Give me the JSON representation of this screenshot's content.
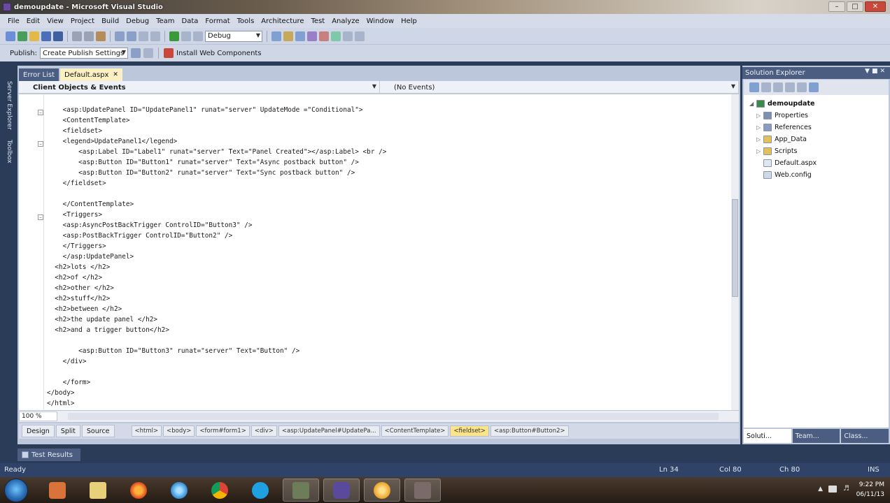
{
  "window": {
    "title": "demoupdate - Microsoft Visual Studio"
  },
  "menu": [
    "File",
    "Edit",
    "View",
    "Project",
    "Build",
    "Debug",
    "Team",
    "Data",
    "Format",
    "Tools",
    "Architecture",
    "Test",
    "Analyze",
    "Window",
    "Help"
  ],
  "toolbar": {
    "config_combo": "Debug",
    "publish_label": "Publish:",
    "publish_combo": "Create Publish Settings",
    "install_label": "Install Web Components"
  },
  "left_strip": {
    "server_explorer": "Server Explorer",
    "toolbox": "Toolbox"
  },
  "editor": {
    "tabs": [
      {
        "label": "Error List",
        "active": false
      },
      {
        "label": "Default.aspx",
        "active": true
      }
    ],
    "nav_left": "Client Objects & Events",
    "nav_right": "(No Events)",
    "zoom": "100 %",
    "view_buttons": [
      "Design",
      "Split",
      "Source"
    ],
    "breadcrumbs": [
      "<html>",
      "<body>",
      "<form#form1>",
      "<div>",
      "<asp:UpdatePanel#UpdatePa...",
      "<ContentTemplate>",
      "<fieldset>",
      "<asp:Button#Button2>"
    ],
    "active_crumb": 6,
    "lines": [
      "    <asp:UpdatePanel ID=\"UpdatePanel1\" runat=\"server\" UpdateMode =\"Conditional\">",
      "    <ContentTemplate>",
      "    <fieldset>",
      "    <legend>UpdatePanel1</legend>",
      "        <asp:Label ID=\"Label1\" runat=\"server\" Text=\"Panel Created\"></asp:Label> <br />",
      "        <asp:Button ID=\"Button1\" runat=\"server\" Text=\"Async postback button\" />",
      "        <asp:Button ID=\"Button2\" runat=\"server\" Text=\"Sync postback button\" />",
      "    </fieldset>",
      "",
      "    </ContentTemplate>",
      "    <Triggers>",
      "    <asp:AsyncPostBackTrigger ControlID=\"Button3\" />",
      "    <asp:PostBackTrigger ControlID=\"Button2\" />",
      "    </Triggers>",
      "    </asp:UpdatePanel>",
      "  <h2>lots </h2>",
      "  <h2>of </h2>",
      "  <h2>other </h2>",
      "  <h2>stuff</h2>",
      "  <h2>between </h2>",
      "  <h2>the update panel </h2>",
      "  <h2>and a trigger button</h2>",
      "",
      "        <asp:Button ID=\"Button3\" runat=\"server\" Text=\"Button\" />",
      "    </div>",
      "",
      "    </form>",
      "</body>",
      "</html>"
    ]
  },
  "solution_explorer": {
    "title": "Solution Explorer",
    "tree": [
      {
        "label": "demoupdate",
        "level": 0,
        "icon": "globe-icon",
        "bold": true
      },
      {
        "label": "Properties",
        "level": 1,
        "icon": "properties-icon"
      },
      {
        "label": "References",
        "level": 1,
        "icon": "references-icon"
      },
      {
        "label": "App_Data",
        "level": 1,
        "icon": "folder-icon"
      },
      {
        "label": "Scripts",
        "level": 1,
        "icon": "folder-icon"
      },
      {
        "label": "Default.aspx",
        "level": 1,
        "icon": "aspx-file-icon"
      },
      {
        "label": "Web.config",
        "level": 1,
        "icon": "config-file-icon"
      }
    ],
    "bottom_tabs": [
      "Soluti...",
      "Team...",
      "Class..."
    ]
  },
  "bottom_panel": {
    "test_results": "Test Results"
  },
  "statusbar": {
    "ready": "Ready",
    "ln": "Ln 34",
    "col": "Col 80",
    "ch": "Ch 80",
    "ins": "INS"
  },
  "taskbar": {
    "time": "9:22 PM",
    "date": "06/11/13"
  },
  "colors": {
    "accent": "#2f4267",
    "tab_active": "#fbf0c3",
    "markup_blue": "#0000ff",
    "crumb_active": "#fbe48a"
  }
}
